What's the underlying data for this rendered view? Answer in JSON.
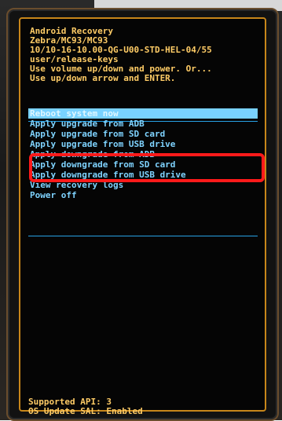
{
  "header": {
    "lines": [
      "Android Recovery",
      "Zebra/MC93/MC93",
      "10/10-16-10.00-QG-U00-STD-HEL-04/55",
      "user/release-keys",
      "Use volume up/down and power. Or...",
      "Use up/down arrow and ENTER."
    ]
  },
  "menu": {
    "items": [
      {
        "label": "Reboot system now",
        "selected": true
      },
      {
        "label": "Apply upgrade from ADB",
        "selected": false
      },
      {
        "label": "Apply upgrade from SD card",
        "selected": false
      },
      {
        "label": "Apply upgrade from USB drive",
        "selected": false
      },
      {
        "label": "Apply downgrade from ADB",
        "selected": false
      },
      {
        "label": "Apply downgrade from SD card",
        "selected": false
      },
      {
        "label": "Apply downgrade from USB drive",
        "selected": false
      },
      {
        "label": "View recovery logs",
        "selected": false
      },
      {
        "label": "Power off",
        "selected": false
      }
    ],
    "highlighted_item": "Apply upgrade from USB drive"
  },
  "footer": {
    "lines": [
      "Supported API: 3",
      "OS Update SAL: Enabled"
    ]
  },
  "colors": {
    "header_text": "#ffcc66",
    "menu_text": "#7fd3ff",
    "selected_bg": "#79d2ff",
    "highlight_border": "#ff1a1a",
    "screen_bezel": "#c7861a"
  }
}
